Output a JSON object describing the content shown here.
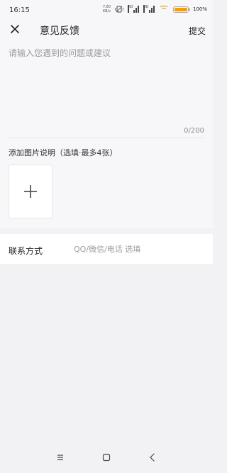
{
  "status_bar": {
    "time": "16:15",
    "network_speed_value": "7.80",
    "network_speed_unit": "KB/s",
    "signal_1_label": "HD",
    "signal_2_label": "HD",
    "battery_text": "100%",
    "battery_level": 1.0,
    "icons": [
      "network-speed-icon",
      "vibrate-icon",
      "signal-icon",
      "signal-icon",
      "wifi-icon",
      "battery-icon"
    ],
    "colors": {
      "battery_fill": "#ff9b00",
      "wifi": "#d29a00"
    }
  },
  "header": {
    "close_icon": "close-icon",
    "title": "意见反馈",
    "submit_label": "提交"
  },
  "feedback": {
    "placeholder": "请输入您遇到的问题或建议",
    "value": "",
    "counter": "0/200"
  },
  "images": {
    "label": "添加图片说明（选填·最多4张）",
    "add_icon": "plus-icon"
  },
  "contact": {
    "label": "联系方式",
    "placeholder": "QQ/微信/电话 选填",
    "value": ""
  },
  "nav_bar": {
    "buttons": [
      "menu-icon",
      "home-icon",
      "back-icon"
    ]
  }
}
